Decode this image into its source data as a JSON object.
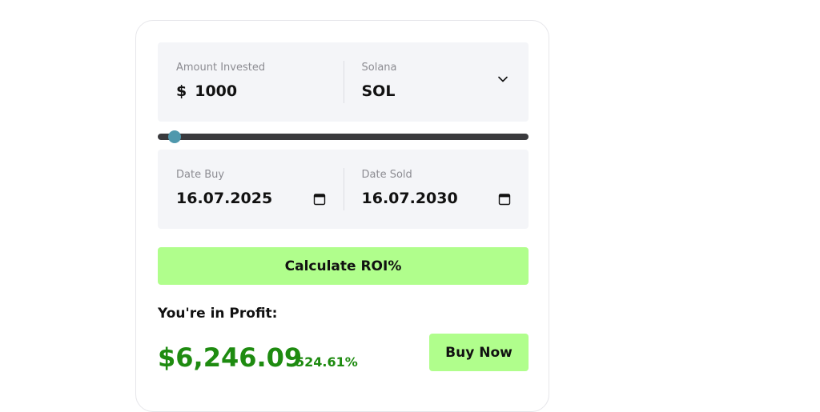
{
  "investment": {
    "amount_label": "Amount Invested",
    "currency_symbol": "$",
    "amount_value": "1000",
    "coin_label": "Solana",
    "coin_value": "SOL",
    "dropdown_icon": "chevron-down-icon"
  },
  "slider": {
    "level_fraction": 0.028,
    "track_color": "#3a3a3d",
    "thumb_color": "#4f98ad"
  },
  "dates": {
    "buy_label": "Date Buy",
    "buy_value": "16.07.2025",
    "sold_label": "Date Sold",
    "sold_value": "16.07.2030",
    "picker_icon": "calendar-icon"
  },
  "actions": {
    "calculate_label": "Calculate ROI%",
    "buy_label": "Buy Now"
  },
  "result": {
    "title": "You're in Profit:",
    "amount": "$6,246.09",
    "percent": "524.61%"
  },
  "colors": {
    "accent_green": "#b0fe8c",
    "profit_green": "#1e8b10",
    "panel_bg": "#f4f5f8"
  }
}
